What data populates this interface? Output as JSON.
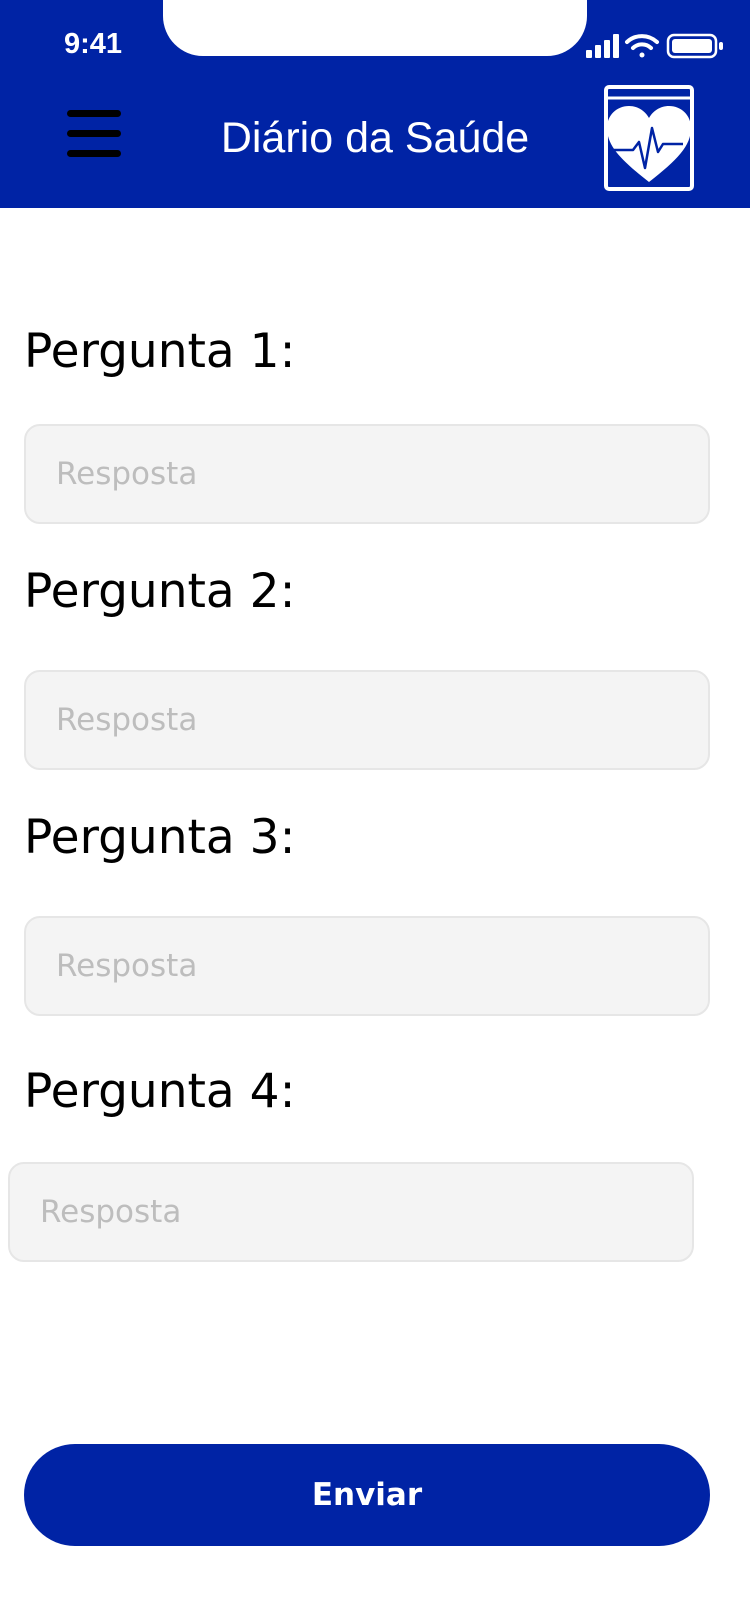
{
  "status_bar": {
    "time": "9:41",
    "icons": [
      "cellular-signal-icon",
      "wifi-icon",
      "battery-icon"
    ]
  },
  "header": {
    "title": "Diário da Saúde",
    "menu_icon": "hamburger-menu-icon",
    "logo_icon": "health-diary-book-heart-icon"
  },
  "form": {
    "questions": [
      {
        "label": "Pergunta 1:",
        "placeholder": "Resposta"
      },
      {
        "label": "Pergunta 2:",
        "placeholder": "Resposta"
      },
      {
        "label": "Pergunta 3:",
        "placeholder": "Resposta"
      },
      {
        "label": "Pergunta 4:",
        "placeholder": "Resposta"
      }
    ],
    "submit_label": "Enviar"
  },
  "colors": {
    "primary": "#0023A5",
    "field_background": "#f4f4f4",
    "placeholder": "#bdbdbd"
  }
}
